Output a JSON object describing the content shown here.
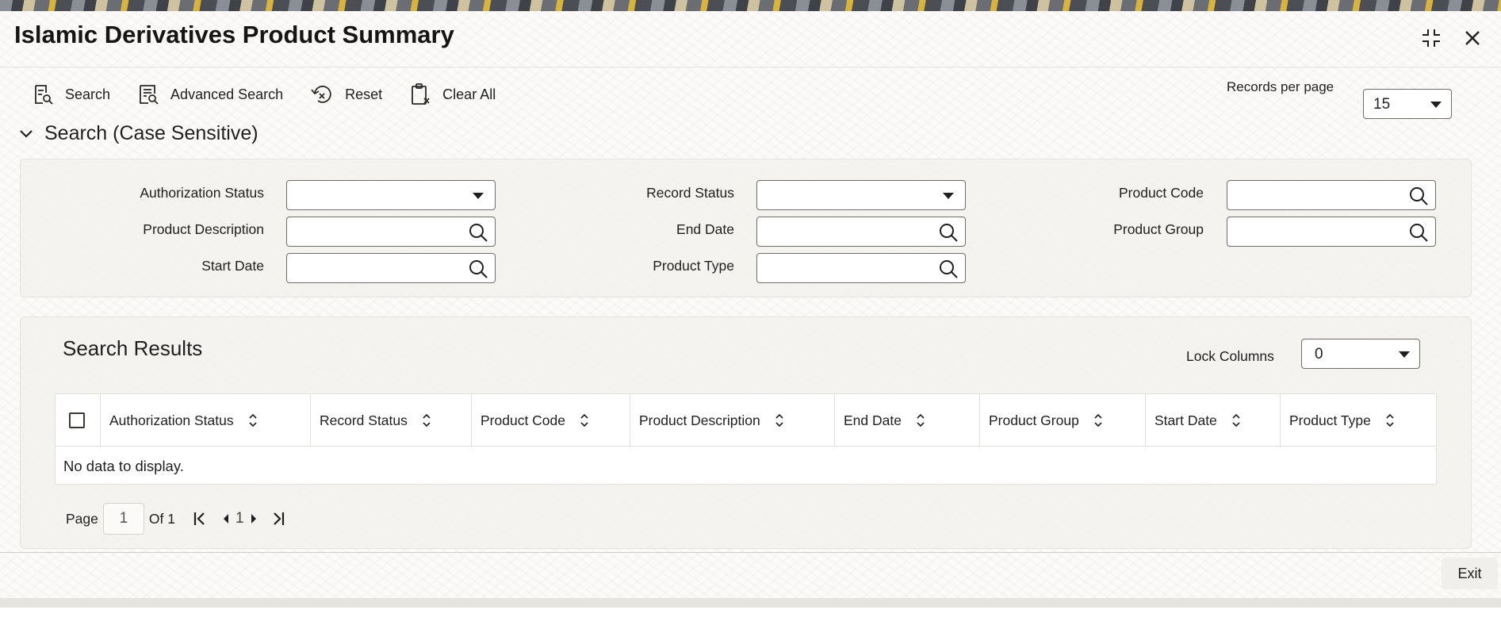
{
  "window": {
    "title": "Islamic Derivatives Product Summary"
  },
  "toolbar": {
    "search_label": "Search",
    "advanced_search_label": "Advanced Search",
    "reset_label": "Reset",
    "clear_all_label": "Clear All"
  },
  "records_per_page": {
    "label": "Records per page",
    "value": "15"
  },
  "search_section": {
    "title": "Search (Case Sensitive)",
    "fields": {
      "authorization_status": "Authorization Status",
      "record_status": "Record Status",
      "product_code": "Product Code",
      "product_description": "Product Description",
      "end_date": "End Date",
      "product_group": "Product Group",
      "start_date": "Start Date",
      "product_type": "Product Type"
    }
  },
  "results": {
    "title": "Search Results",
    "lock_columns_label": "Lock Columns",
    "lock_columns_value": "0",
    "columns": [
      "Authorization Status",
      "Record Status",
      "Product Code",
      "Product Description",
      "End Date",
      "Product Group",
      "Start Date",
      "Product Type"
    ],
    "empty_message": "No data to display."
  },
  "pagination": {
    "page_label": "Page",
    "current_page": "1",
    "of_label": "Of 1",
    "page_number": "1"
  },
  "footer": {
    "exit_label": "Exit"
  }
}
